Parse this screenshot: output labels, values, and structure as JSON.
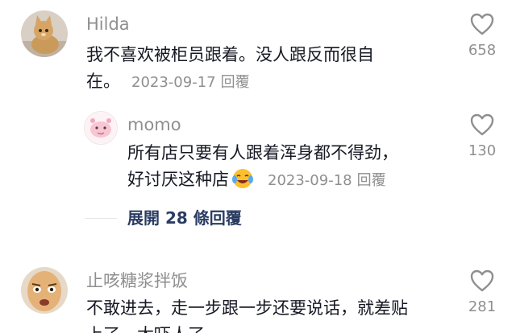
{
  "comments": [
    {
      "username": "Hilda",
      "line1": "我不喜欢被柜员跟着。没人跟反而很自",
      "line2": "在。",
      "date": "2023-09-17",
      "reply": "回覆",
      "likes": "658",
      "avatar_icon": "cat-avatar-icon"
    },
    {
      "username": "止咳糖浆拌饭",
      "line1": "不敢进去，走一步跟一步还要说话，就差贴",
      "line2": "上了，太吓人了",
      "likes": "281",
      "avatar_icon": "bald-man-avatar-icon"
    }
  ],
  "reply": {
    "username": "momo",
    "line1": "所有店只要有人跟着浑身都不得劲，",
    "line2": "好讨厌这种店",
    "emoji": "crying-laughing-emoji",
    "date": "2023-09-18",
    "reply": "回覆",
    "likes": "130",
    "avatar_icon": "pink-doodle-avatar-icon"
  },
  "expand_label": "展開 28 條回覆",
  "colors": {
    "text": "#161823",
    "secondary": "#8f8f8f",
    "link": "#2b3c63"
  }
}
